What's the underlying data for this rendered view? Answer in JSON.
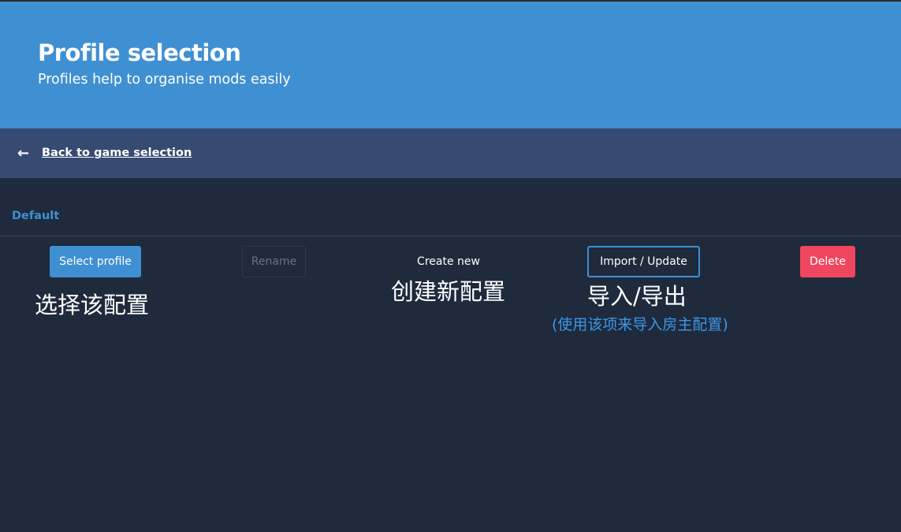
{
  "header": {
    "title": "Profile selection",
    "subtitle": "Profiles help to organise mods easily"
  },
  "nav": {
    "back_arrow": "←",
    "back_label": "Back to game selection"
  },
  "profile": {
    "name": "Default"
  },
  "actions": {
    "select_label": "Select profile",
    "rename_label": "Rename",
    "create_label": "Create new",
    "import_label": "Import / Update",
    "delete_label": "Delete"
  },
  "annotations": {
    "select_note": "选择该配置",
    "create_note": "创建新配置",
    "import_note": "导入/导出",
    "import_detail": "(使用该项来导入房主配置)"
  },
  "colors": {
    "header_bg": "#3f90d2",
    "nav_bg": "#374a71",
    "page_bg": "#1f2a3c",
    "primary": "#3f90d2",
    "danger": "#f0465f",
    "annotation_blue": "#3b97e8"
  },
  "icons": {
    "back": "arrow-left-icon"
  }
}
